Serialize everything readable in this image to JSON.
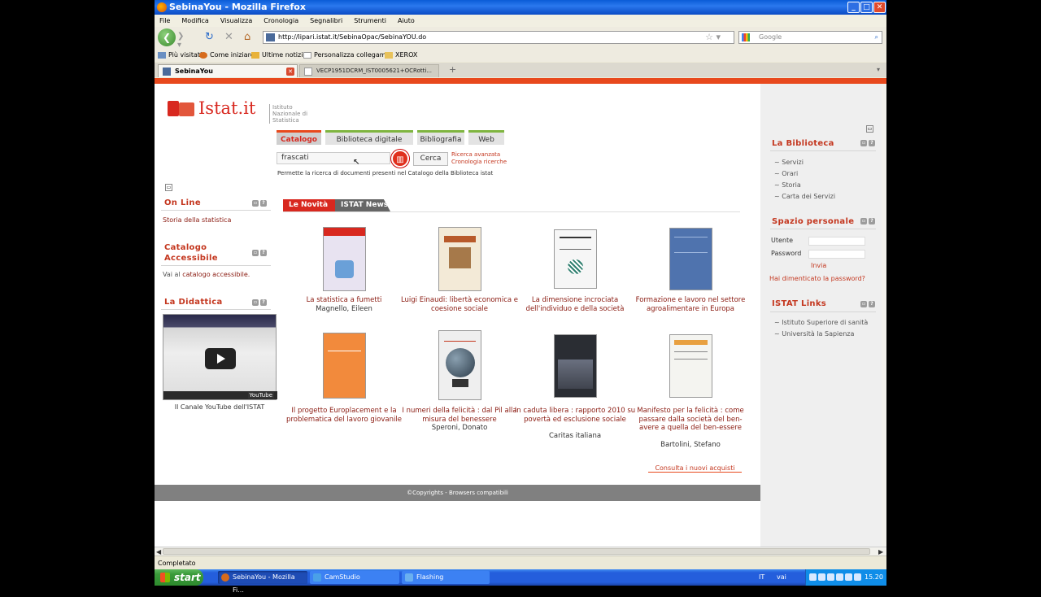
{
  "window": {
    "title": "SebinaYou - Mozilla Firefox",
    "min_icon": "minimize-icon",
    "max_icon": "maximize-icon",
    "close_icon": "close-icon"
  },
  "menubar": [
    "File",
    "Modifica",
    "Visualizza",
    "Cronologia",
    "Segnalibri",
    "Strumenti",
    "Aiuto"
  ],
  "nav": {
    "url": "http://lipari.istat.it/SebinaOpac/SebinaYOU.do",
    "search_placeholder": "Google"
  },
  "bookmarks": [
    "Più visitati",
    "Come iniziare",
    "Ultime notizie",
    "Personalizza collegam...",
    "XEROX"
  ],
  "tabs": [
    {
      "label": "SebinaYou",
      "active": true
    },
    {
      "label": "VECP1951DCRM_IST0005621+OCRotti...",
      "active": false
    }
  ],
  "site": {
    "logo": "Istat.it",
    "logo_sub": "Istituto Nazionale di Statistica",
    "catalog_tabs": [
      "Catalogo",
      "Biblioteca digitale",
      "Bibliografia",
      "Web"
    ],
    "search_value": "frascati",
    "search_button": "Cerca",
    "advanced_search": "Ricerca avanzata",
    "search_history": "Cronologia ricerche",
    "search_hint": "Permette la ricerca di documenti presenti nel Catalogo della Biblioteca istat",
    "news_tabs": [
      "Le Novità",
      "ISTAT News"
    ],
    "acquisti_link": "Consulta i nuovi acquisti",
    "footer": "©Copyrights  -  Browsers compatibili"
  },
  "left": {
    "online_title": "On Line",
    "online_link": "Storia della statistica",
    "catalogo_title": "Catalogo Accessibile",
    "catalogo_prefix": "Vai al",
    "catalogo_link": "catalogo accessibile.",
    "didattica_title": "La Didattica",
    "video_caption": "Il Canale YouTube dell'ISTAT",
    "video_logo": "YouTube"
  },
  "books": [
    {
      "title": "La statistica a fumetti",
      "author": "Magnello, Eileen",
      "color": "#E8E3F1"
    },
    {
      "title": "Luigi Einaudi: libertà economica e coesione sociale",
      "author": "",
      "color": "#F3EAD7"
    },
    {
      "title": "La dimensione incrociata dell'individuo e della società",
      "author": "",
      "color": "#F6F6F6"
    },
    {
      "title": "Formazione e lavoro nel settore agroalimentare in Europa",
      "author": "",
      "color": "#4F73AE"
    },
    {
      "title": "Il progetto Europlacement e la problematica del lavoro giovanile",
      "author": "",
      "color": "#F28A3C"
    },
    {
      "title": "I numeri della felicità : dal Pil alla misura del benessere",
      "author": "Speroni, Donato",
      "color": "#EFEFEF"
    },
    {
      "title": "In caduta libera : rapporto 2010 su povertà ed esclusione sociale",
      "author": "Caritas italiana",
      "color": "#2A2D33"
    },
    {
      "title": "Manifesto per la felicità : come passare dalla società del ben-avere a quella del ben-essere",
      "author": "Bartolini, Stefano",
      "color": "#F4F4F0"
    }
  ],
  "right": {
    "biblioteca_title": "La Biblioteca",
    "biblioteca_links": [
      "Servizi",
      "Orari",
      "Storia",
      "Carta dei Servizi"
    ],
    "spazio_title": "Spazio personale",
    "utente_label": "Utente",
    "password_label": "Password",
    "invia": "Invia",
    "forgot": "Hai dimenticato la password?",
    "links_title": "ISTAT Links",
    "istat_links": [
      "Istituto Superiore di sanità",
      "Università la Sapienza"
    ]
  },
  "statusbar": "Completato",
  "taskbar": {
    "start": "start",
    "items": [
      "SebinaYou - Mozilla Fi...",
      "CamStudio",
      "Flashing"
    ],
    "lang": "IT",
    "vai": "vai",
    "clock": "15.20"
  }
}
